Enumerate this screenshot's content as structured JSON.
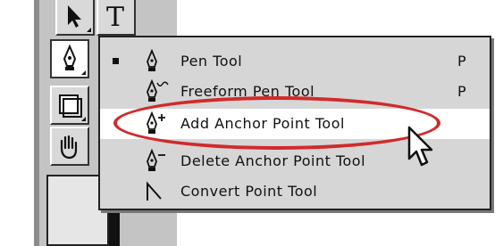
{
  "toolbox": {
    "tools": [
      {
        "name": "move-arrow-icon"
      },
      {
        "name": "type-tool-icon",
        "glyph": "T"
      },
      {
        "name": "pen-icon"
      },
      {
        "name": "note-icon"
      },
      {
        "name": "hand-icon"
      }
    ]
  },
  "menu": {
    "items": [
      {
        "label": "Pen Tool",
        "shortcut": "P",
        "selected": true,
        "icon": "pen-icon"
      },
      {
        "label": "Freeform Pen Tool",
        "shortcut": "P",
        "selected": false,
        "icon": "freeform-pen-icon"
      },
      {
        "label": "Add Anchor Point Tool",
        "shortcut": "",
        "selected": false,
        "highlighted": true,
        "icon": "add-anchor-point-icon"
      },
      {
        "label": "Delete Anchor Point Tool",
        "shortcut": "",
        "selected": false,
        "icon": "delete-anchor-point-icon"
      },
      {
        "label": "Convert Point Tool",
        "shortcut": "",
        "selected": false,
        "icon": "convert-point-icon"
      }
    ]
  },
  "colors": {
    "highlight_circle": "#d12a2a",
    "menu_bg": "#d6d6d6",
    "toolbox_bg": "#c4c4c4"
  }
}
